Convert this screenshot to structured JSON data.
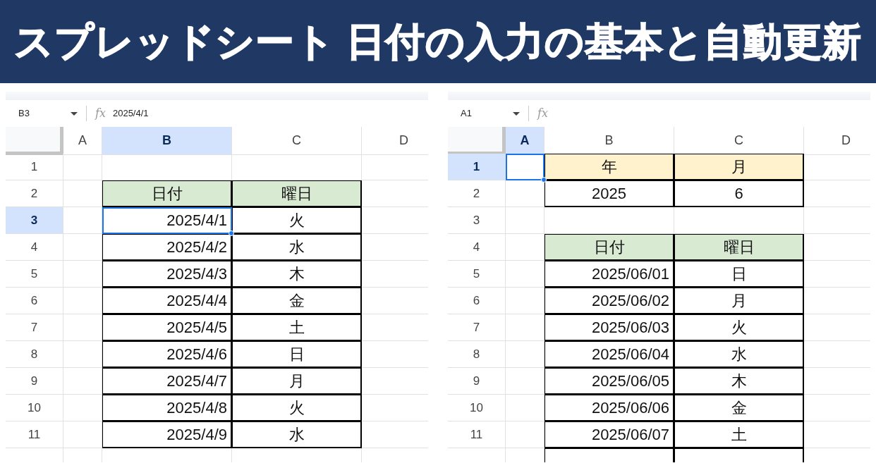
{
  "title": "スプレッドシート 日付の入力の基本と自動更新",
  "sheets": [
    {
      "name_box": "B3",
      "fx": "fx",
      "formula": "2025/4/1",
      "columns": [
        {
          "label": "A",
          "selected": false
        },
        {
          "label": "B",
          "selected": true
        },
        {
          "label": "C",
          "selected": false
        },
        {
          "label": "D",
          "selected": false
        }
      ],
      "rows": [
        {
          "number": "1",
          "selected": false,
          "cells": [
            {
              "selected": false
            },
            {
              "selected": false
            },
            {
              "selected": false
            }
          ]
        },
        {
          "number": "2",
          "selected": false,
          "cells": [
            {
              "selected": false
            },
            {
              "text": "日付",
              "kind": "text",
              "color": "#d9ead3",
              "bordered": true,
              "selected": false
            },
            {
              "text": "曜日",
              "kind": "text",
              "color": "#d9ead3",
              "bordered": true,
              "selected": false
            }
          ]
        },
        {
          "number": "3",
          "selected": true,
          "cells": [
            {
              "selected": false
            },
            {
              "text": "2025/4/1",
              "kind": "date",
              "bordered": true,
              "selected": true
            },
            {
              "text": "火",
              "kind": "text",
              "bordered": true,
              "selected": false
            }
          ]
        },
        {
          "number": "4",
          "selected": false,
          "cells": [
            {
              "selected": false
            },
            {
              "text": "2025/4/2",
              "kind": "date",
              "bordered": true,
              "selected": false
            },
            {
              "text": "水",
              "kind": "text",
              "bordered": true,
              "selected": false
            }
          ]
        },
        {
          "number": "5",
          "selected": false,
          "cells": [
            {
              "selected": false
            },
            {
              "text": "2025/4/3",
              "kind": "date",
              "bordered": true,
              "selected": false
            },
            {
              "text": "木",
              "kind": "text",
              "bordered": true,
              "selected": false
            }
          ]
        },
        {
          "number": "6",
          "selected": false,
          "cells": [
            {
              "selected": false
            },
            {
              "text": "2025/4/4",
              "kind": "date",
              "bordered": true,
              "selected": false
            },
            {
              "text": "金",
              "kind": "text",
              "bordered": true,
              "selected": false
            }
          ]
        },
        {
          "number": "7",
          "selected": false,
          "cells": [
            {
              "selected": false
            },
            {
              "text": "2025/4/5",
              "kind": "date",
              "bordered": true,
              "selected": false
            },
            {
              "text": "土",
              "kind": "text",
              "bordered": true,
              "selected": false
            }
          ]
        },
        {
          "number": "8",
          "selected": false,
          "cells": [
            {
              "selected": false
            },
            {
              "text": "2025/4/6",
              "kind": "date",
              "bordered": true,
              "selected": false
            },
            {
              "text": "日",
              "kind": "text",
              "bordered": true,
              "selected": false
            }
          ]
        },
        {
          "number": "9",
          "selected": false,
          "cells": [
            {
              "selected": false
            },
            {
              "text": "2025/4/7",
              "kind": "date",
              "bordered": true,
              "selected": false
            },
            {
              "text": "月",
              "kind": "text",
              "bordered": true,
              "selected": false
            }
          ]
        },
        {
          "number": "10",
          "selected": false,
          "cells": [
            {
              "selected": false
            },
            {
              "text": "2025/4/8",
              "kind": "date",
              "bordered": true,
              "selected": false
            },
            {
              "text": "火",
              "kind": "text",
              "bordered": true,
              "selected": false
            }
          ]
        },
        {
          "number": "11",
          "selected": false,
          "cells": [
            {
              "selected": false
            },
            {
              "text": "2025/4/9",
              "kind": "date",
              "bordered": true,
              "selected": false
            },
            {
              "text": "水",
              "kind": "text",
              "bordered": true,
              "selected": false
            }
          ]
        },
        {
          "selected": false,
          "cells": [
            {
              "selected": false
            },
            {
              "selected": false
            },
            {
              "selected": false
            }
          ]
        }
      ]
    },
    {
      "name_box": "A1",
      "fx": "fx",
      "columns": [
        {
          "label": "A",
          "selected": true
        },
        {
          "label": "B",
          "selected": false
        },
        {
          "label": "C",
          "selected": false
        },
        {
          "label": "D",
          "selected": false
        }
      ],
      "rows": [
        {
          "number": "1",
          "selected": true,
          "cells": [
            {
              "selected": true
            },
            {
              "text": "年",
              "kind": "text",
              "color": "#fff2cc",
              "bordered": true,
              "selected": false
            },
            {
              "text": "月",
              "kind": "text",
              "color": "#fff2cc",
              "bordered": true,
              "selected": false
            }
          ]
        },
        {
          "number": "2",
          "selected": false,
          "cells": [
            {
              "selected": false
            },
            {
              "text": "2025",
              "kind": "text",
              "bordered": true,
              "selected": false
            },
            {
              "text": "6",
              "kind": "text",
              "bordered": true,
              "selected": false
            }
          ]
        },
        {
          "number": "3",
          "selected": false,
          "cells": [
            {
              "selected": false
            },
            {
              "selected": false
            },
            {
              "selected": false
            }
          ]
        },
        {
          "number": "4",
          "selected": false,
          "cells": [
            {
              "selected": false
            },
            {
              "text": "日付",
              "kind": "text",
              "color": "#d9ead3",
              "bordered": true,
              "selected": false
            },
            {
              "text": "曜日",
              "kind": "text",
              "color": "#d9ead3",
              "bordered": true,
              "selected": false
            }
          ]
        },
        {
          "number": "5",
          "selected": false,
          "cells": [
            {
              "selected": false
            },
            {
              "text": "2025/06/01",
              "kind": "date",
              "bordered": true,
              "selected": false
            },
            {
              "text": "日",
              "kind": "text",
              "bordered": true,
              "selected": false
            }
          ]
        },
        {
          "number": "6",
          "selected": false,
          "cells": [
            {
              "selected": false
            },
            {
              "text": "2025/06/02",
              "kind": "date",
              "bordered": true,
              "selected": false
            },
            {
              "text": "月",
              "kind": "text",
              "bordered": true,
              "selected": false
            }
          ]
        },
        {
          "number": "7",
          "selected": false,
          "cells": [
            {
              "selected": false
            },
            {
              "text": "2025/06/03",
              "kind": "date",
              "bordered": true,
              "selected": false
            },
            {
              "text": "火",
              "kind": "text",
              "bordered": true,
              "selected": false
            }
          ]
        },
        {
          "number": "8",
          "selected": false,
          "cells": [
            {
              "selected": false
            },
            {
              "text": "2025/06/04",
              "kind": "date",
              "bordered": true,
              "selected": false
            },
            {
              "text": "水",
              "kind": "text",
              "bordered": true,
              "selected": false
            }
          ]
        },
        {
          "number": "9",
          "selected": false,
          "cells": [
            {
              "selected": false
            },
            {
              "text": "2025/06/05",
              "kind": "date",
              "bordered": true,
              "selected": false
            },
            {
              "text": "木",
              "kind": "text",
              "bordered": true,
              "selected": false
            }
          ]
        },
        {
          "number": "10",
          "selected": false,
          "cells": [
            {
              "selected": false
            },
            {
              "text": "2025/06/06",
              "kind": "date",
              "bordered": true,
              "selected": false
            },
            {
              "text": "金",
              "kind": "text",
              "bordered": true,
              "selected": false
            }
          ]
        },
        {
          "number": "11",
          "selected": false,
          "cells": [
            {
              "selected": false
            },
            {
              "text": "2025/06/07",
              "kind": "date",
              "bordered": true,
              "selected": false
            },
            {
              "text": "土",
              "kind": "text",
              "bordered": true,
              "selected": false
            }
          ]
        },
        {
          "selected": false,
          "cells": [
            {
              "selected": false
            },
            {
              "bordered": true,
              "selected": false
            },
            {
              "bordered": true,
              "selected": false
            }
          ]
        }
      ]
    }
  ]
}
